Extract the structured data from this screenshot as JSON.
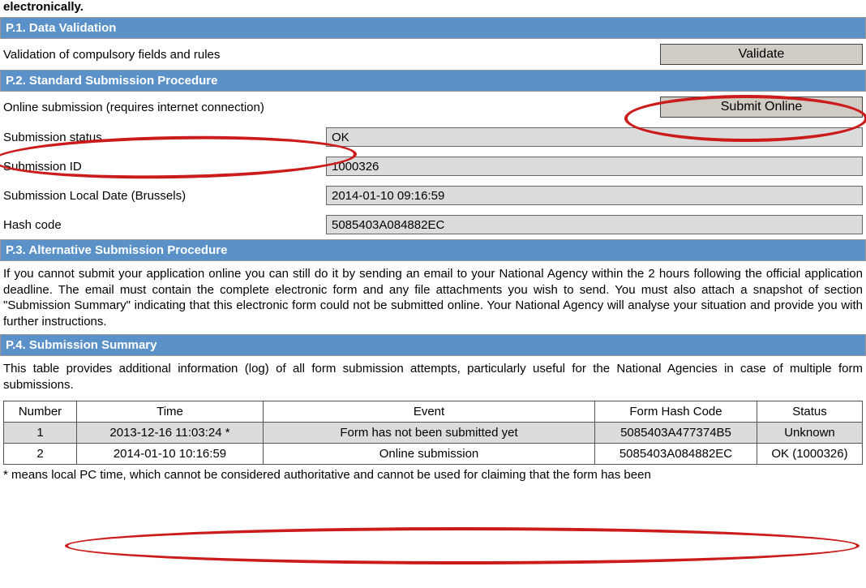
{
  "top_fragment": "electronically.",
  "p1": {
    "header": "P.1. Data Validation",
    "label": "Validation of compulsory fields and rules",
    "button": "Validate"
  },
  "p2": {
    "header": "P.2. Standard Submission Procedure",
    "label": "Online submission (requires internet connection)",
    "button": "Submit Online",
    "fields": {
      "status_label": "Submission status",
      "status_value": "OK",
      "id_label": "Submission ID",
      "id_value": "1000326",
      "date_label": "Submission Local Date (Brussels)",
      "date_value": "2014-01-10 09:16:59",
      "hash_label": "Hash code",
      "hash_value": "5085403A084882EC"
    }
  },
  "p3": {
    "header": "P.3. Alternative Submission Procedure",
    "text": "If you cannot submit your application online you can still do it by sending an email to your National Agency within the 2 hours following the official application deadline. The email must contain the complete electronic form and any file attachments you wish to send. You must also attach a snapshot of section \"Submission Summary\" indicating that this electronic form could not be submitted online. Your National Agency will analyse your situation and provide you with further instructions."
  },
  "p4": {
    "header": "P.4. Submission Summary",
    "intro": "This table provides additional information (log) of all form submission attempts, particularly useful for the National Agencies in case of multiple form submissions.",
    "columns": {
      "number": "Number",
      "time": "Time",
      "event": "Event",
      "hash": "Form Hash Code",
      "status": "Status"
    },
    "rows": [
      {
        "number": "1",
        "time": "2013-12-16 11:03:24 *",
        "event": "Form has not been submitted yet",
        "hash": "5085403A477374B5",
        "status": "Unknown"
      },
      {
        "number": "2",
        "time": "2014-01-10 10:16:59",
        "event": "Online submission",
        "hash": "5085403A084882EC",
        "status": "OK (1000326)"
      }
    ],
    "footnote": "* means local PC time, which cannot be considered authoritative and cannot be used for claiming that the form has been"
  }
}
